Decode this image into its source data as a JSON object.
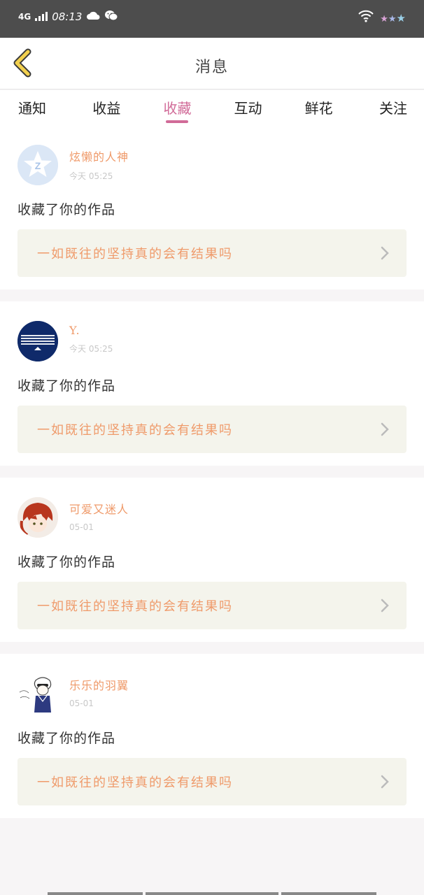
{
  "status_bar": {
    "network": "4G",
    "time": "08:13"
  },
  "header": {
    "title": "消息"
  },
  "tabs": [
    {
      "label": "通知",
      "active": false
    },
    {
      "label": "收益",
      "active": false
    },
    {
      "label": "收藏",
      "active": true
    },
    {
      "label": "互动",
      "active": false
    },
    {
      "label": "鲜花",
      "active": false
    },
    {
      "label": "关注",
      "active": false
    }
  ],
  "messages": [
    {
      "username": "炫懒的人神",
      "time": "今天 05:25",
      "action": "收藏了你的作品",
      "work_title": "一如既往的坚持真的会有结果吗",
      "avatar": "qq-default-avatar"
    },
    {
      "username": "Y.",
      "time": "今天 05:25",
      "action": "收藏了你的作品",
      "work_title": "一如既往的坚持真的会有结果吗",
      "avatar": "navy-avatar"
    },
    {
      "username": "可爱又迷人",
      "time": "05-01",
      "action": "收藏了你的作品",
      "work_title": "一如既往的坚持真的会有结果吗",
      "avatar": "anime-avatar"
    },
    {
      "username": "乐乐的羽翼",
      "time": "05-01",
      "action": "收藏了你的作品",
      "work_title": "一如既往的坚持真的会有结果吗",
      "avatar": "sketch-avatar"
    }
  ],
  "colors": {
    "accent": "#d16b98",
    "username": "#ef9a6a",
    "work_bg": "#f4f4ec",
    "statusbar": "#4d4d4d"
  }
}
